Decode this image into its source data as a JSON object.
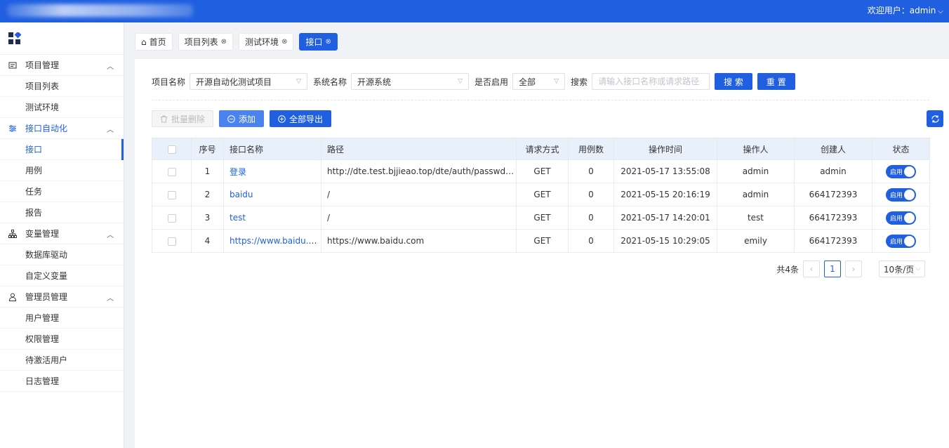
{
  "header": {
    "user_label": "欢迎用户：admin"
  },
  "sidebar": {
    "groups": [
      {
        "label": "项目管理",
        "items": [
          "项目列表",
          "测试环境"
        ]
      },
      {
        "label": "接口自动化",
        "items": [
          "接口",
          "用例",
          "任务",
          "报告"
        ]
      },
      {
        "label": "变量管理",
        "items": [
          "数据库驱动",
          "自定义变量"
        ]
      },
      {
        "label": "管理员管理",
        "items": [
          "用户管理",
          "权限管理",
          "待激活用户",
          "日志管理"
        ]
      }
    ],
    "active_item": "接口"
  },
  "tabs": [
    {
      "label": "首页"
    },
    {
      "label": "项目列表"
    },
    {
      "label": "测试环境"
    },
    {
      "label": "接口"
    }
  ],
  "filters": {
    "project_label": "项目名称",
    "project_value": "开源自动化测试项目",
    "system_label": "系统名称",
    "system_value": "开源系统",
    "enabled_label": "是否启用",
    "enabled_value": "全部",
    "search_label": "搜索",
    "search_placeholder": "请输入接口名称或请求路径",
    "search_button": "搜 索",
    "reset_button": "重 置"
  },
  "actions": {
    "batch_delete": "批量删除",
    "add": "添加",
    "export_all": "全部导出"
  },
  "table": {
    "columns": [
      "序号",
      "接口名称",
      "路径",
      "请求方式",
      "用例数",
      "操作时间",
      "操作人",
      "创建人",
      "状态"
    ],
    "rows": [
      {
        "no": "1",
        "name": "登录",
        "path": "http://dte.test.bjjieao.top/dte/auth/passwd_login?...",
        "method": "GET",
        "cases": "0",
        "time": "2021-05-17 13:55:08",
        "operator": "admin",
        "creator": "admin",
        "status": "启用"
      },
      {
        "no": "2",
        "name": "baidu",
        "path": "/",
        "method": "GET",
        "cases": "0",
        "time": "2021-05-15 20:16:19",
        "operator": "admin",
        "creator": "664172393",
        "status": "启用"
      },
      {
        "no": "3",
        "name": "test",
        "path": "/",
        "method": "GET",
        "cases": "0",
        "time": "2021-05-17 14:20:01",
        "operator": "test",
        "creator": "664172393",
        "status": "启用"
      },
      {
        "no": "4",
        "name": "https://www.baidu.com",
        "path": "https://www.baidu.com",
        "method": "GET",
        "cases": "0",
        "time": "2021-05-15 10:29:05",
        "operator": "emily",
        "creator": "664172393",
        "status": "启用"
      }
    ]
  },
  "pagination": {
    "total": "共4条",
    "current": "1",
    "page_size": "10条/页"
  }
}
